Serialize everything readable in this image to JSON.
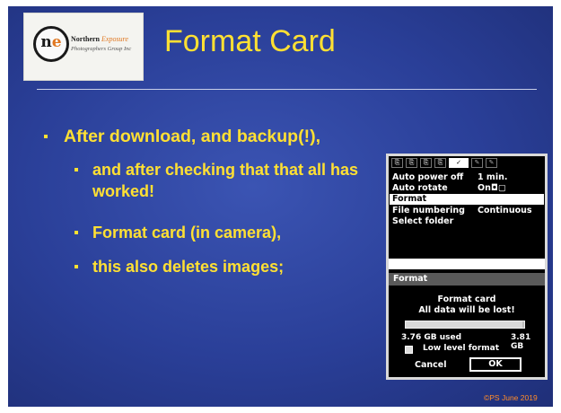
{
  "slide": {
    "title": "Format Card",
    "copyright": "©PS June 2019"
  },
  "logo": {
    "mark_n": "n",
    "mark_e": "e",
    "name_a": "Northern",
    "name_b": "Exposure",
    "subtitle": "Photographers Group Inc"
  },
  "bullets": [
    "After download, and backup(!),",
    "and after checking that that all has worked!",
    "Format card (in camera),",
    "this also deletes images;"
  ],
  "camera": {
    "tabs": [
      "⎘",
      "⎘",
      "⎘",
      "⎘",
      "✓",
      "✎",
      "✎"
    ],
    "menu": [
      {
        "label": "Auto power off",
        "value": "1 min."
      },
      {
        "label": "Auto rotate",
        "value": "On◘▢"
      },
      {
        "label": "Format",
        "value": ""
      },
      {
        "label": "File numbering",
        "value": "Continuous"
      },
      {
        "label": "Select folder",
        "value": ""
      }
    ],
    "dialog": {
      "title": "Format",
      "line1": "Format card",
      "line2": "All data will be lost!",
      "used": "3.76 GB used",
      "total": "3.81 GB",
      "used_fraction": 0.987,
      "low_level": "Low level format",
      "cancel": "Cancel",
      "ok": "OK"
    }
  },
  "colors": {
    "title": "#ffe033",
    "bullet": "#ffe033",
    "background": "#2a3f98",
    "copyright": "#ff8c2a",
    "logo_accent": "#e0761f"
  }
}
